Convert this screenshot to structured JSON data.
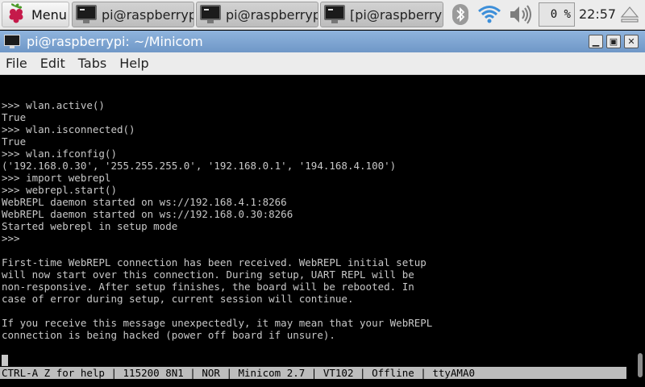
{
  "taskbar": {
    "menu_label": "Menu",
    "tasks": [
      {
        "label": "pi@raspberrypi..."
      },
      {
        "label": "pi@raspberrypi..."
      },
      {
        "label": "[pi@raspberrypi..."
      }
    ],
    "cpu_usage": "0 %",
    "clock": "22:57",
    "icons": {
      "menu": "raspberry-icon",
      "bluetooth": "bluetooth-icon",
      "wifi": "wifi-icon",
      "volume": "volume-icon",
      "eject": "eject-icon"
    }
  },
  "window": {
    "title": "pi@raspberrypi: ~/Minicom",
    "buttons": {
      "minimize": "▁",
      "maximize": "▣",
      "close": "✕"
    },
    "menu": [
      "File",
      "Edit",
      "Tabs",
      "Help"
    ]
  },
  "terminal": {
    "lines": [
      ">>> wlan.active()",
      "True",
      ">>> wlan.isconnected()",
      "True",
      ">>> wlan.ifconfig()",
      "('192.168.0.30', '255.255.255.0', '192.168.0.1', '194.168.4.100')",
      ">>> import webrepl",
      ">>> webrepl.start()",
      "WebREPL daemon started on ws://192.168.4.1:8266",
      "WebREPL daemon started on ws://192.168.0.30:8266",
      "Started webrepl in setup mode",
      ">>>",
      "",
      "First-time WebREPL connection has been received. WebREPL initial setup",
      "will now start over this connection. During setup, UART REPL will be",
      "non-responsive. After setup finishes, the board will be rebooted. In",
      "case of error during setup, current session will continue.",
      "",
      "If you receive this message unexpectedly, it may mean that your WebREPL",
      "connection is being hacked (power off board if unsure)."
    ],
    "status_line": "CTRL-A Z for help | 115200 8N1 | NOR | Minicom 2.7 | VT102 | Offline | ttyAMA0"
  },
  "colors": {
    "titlebar": "#7aa1cf",
    "terminal_bg": "#000000",
    "terminal_fg": "#c8c8c8",
    "statusbar_bg": "#bdbdbd"
  }
}
